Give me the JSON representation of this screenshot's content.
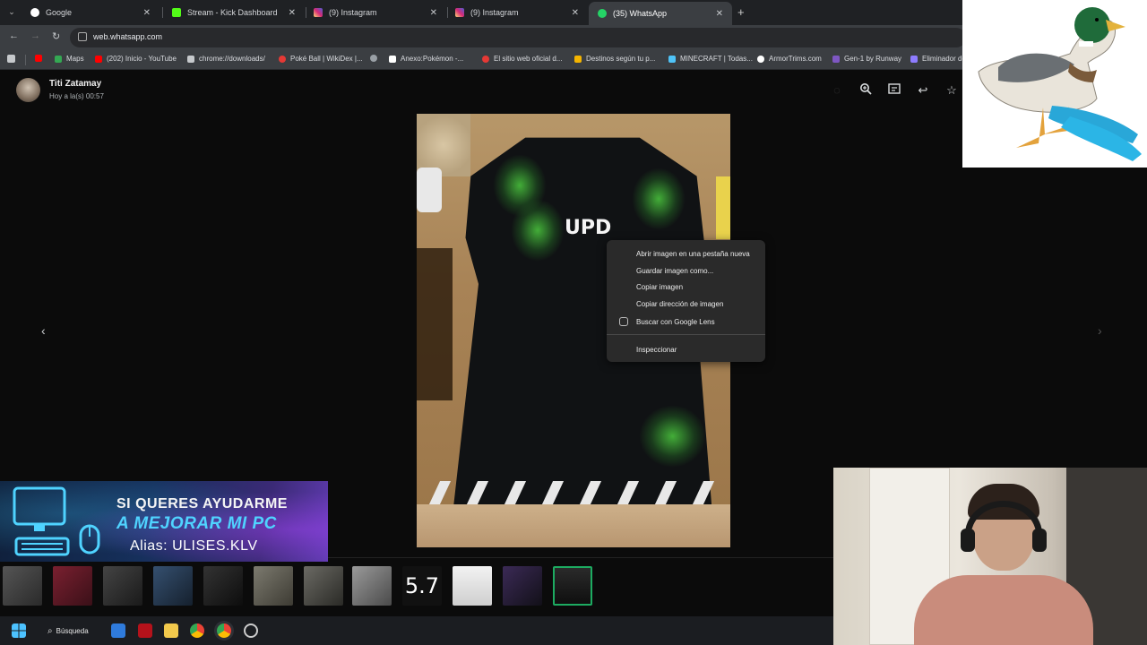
{
  "browser": {
    "tabs": [
      {
        "label": "Google",
        "favicon_color": "#ffffff",
        "active": false
      },
      {
        "label": "Stream - Kick Dashboard",
        "favicon_color": "#53fc18",
        "active": false
      },
      {
        "label": "(9) Instagram",
        "favicon_color": "#d6249f",
        "active": false
      },
      {
        "label": "(9) Instagram",
        "favicon_color": "#d6249f",
        "active": false
      },
      {
        "label": "(35) WhatsApp",
        "favicon_color": "#25d366",
        "active": true
      }
    ],
    "tab_close_glyph": "✕",
    "new_tab_glyph": "+",
    "url": "web.whatsapp.com",
    "bookmarks": [
      {
        "label": "",
        "color": "#ff0000"
      },
      {
        "label": "Maps",
        "color": "#34a853"
      },
      {
        "label": "(202) Inicio - YouTube",
        "color": "#ff0000"
      },
      {
        "label": "chrome://downloads/",
        "color": "#c6c9cc"
      },
      {
        "label": "Poké Ball | WikiDex |...",
        "color": "#e53935"
      },
      {
        "label": "",
        "color": "#9aa0a6"
      },
      {
        "label": "Anexo:Pokémon -...",
        "color": "#ffffff"
      },
      {
        "label": "El sitio web oficial d...",
        "color": "#e53935"
      },
      {
        "label": "Destinos según tu p...",
        "color": "#f4b400"
      },
      {
        "label": "MINECRAFT | Todas...",
        "color": "#4fc3f7"
      },
      {
        "label": "ArmorTrims.com",
        "color": "#ffffff"
      },
      {
        "label": "Gen-1 by Runway",
        "color": "#7e57c2"
      },
      {
        "label": "Eliminador de",
        "color": "#8e7cff"
      }
    ]
  },
  "viewer": {
    "sender_name": "Titi Zatamay",
    "sent_time": "Hoy a la(s) 00:57",
    "shirt_print": "UPD",
    "icons": [
      "zoom-in-icon",
      "caption-icon",
      "reply-icon",
      "star-icon"
    ],
    "context_menu": {
      "items": [
        "Abrir imagen en una pestaña nueva",
        "Guardar imagen como...",
        "Copiar imagen",
        "Copiar dirección de imagen",
        "Buscar con Google Lens"
      ],
      "inspect": "Inspeccionar"
    },
    "thumbnail_label": "5.7",
    "selected_thumbnail": 11
  },
  "banner": {
    "line1": "SI QUERES AYUDARME",
    "line2": "A MEJORAR MI PC",
    "line3": "Alias: ULISES.KLV"
  },
  "taskbar": {
    "search_label": "Búsqueda"
  }
}
